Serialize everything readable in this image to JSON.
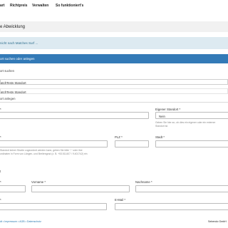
{
  "nav": {
    "items": [
      "art",
      "Richtpreis",
      "Verwalten",
      "So funktioniert's"
    ]
  },
  "page": {
    "heading": "e Abwicklung",
    "info": "nicht nach Matches Surf ..."
  },
  "standort": {
    "panel_title": "ort suchen oder anlegen",
    "search_label": "ort suchen",
    "search_value": "atchTests Standort",
    "selected_value": "atchTests Standort",
    "create_label": "ort anlegen"
  },
  "form": {
    "name_label": "*",
    "eigener_label": "Eigener Standort *",
    "eigener_value": "Nein",
    "eigener_hint": [
      "Geben Sie hier an, ob dies ein eigener oder ein externer",
      "Standort ist."
    ],
    "street_label": "*",
    "street_hint": [
      "Standort keiner Straße zugeordnet werden kann, geben Sie bitte \"-\" oder ihre",
      "ordinaten in Form von Längen- und Breitengrad (z. B. +53.511407 / 9.401742) ein"
    ],
    "plz_label": "PLZ *",
    "stadt_label": "Stadt *",
    "contact_section": "t",
    "anrede_label": "*",
    "vorname_label": "Vorname *",
    "nachname_label": "Nachname *",
    "tel_label": "*",
    "email_label": "E-Mail *"
  },
  "footer": {
    "links": "dt • Impressum • AGB • Datenschutz",
    "right": "Sebendo GmbH"
  }
}
